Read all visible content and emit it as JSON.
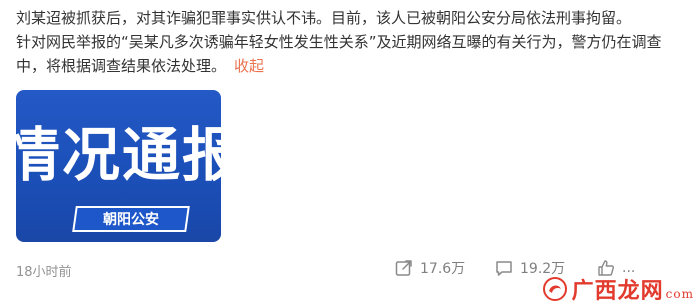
{
  "post": {
    "line1": "刘某迢被抓获后，对其诈骗犯罪事实供认不讳。目前，该人已被朝阳公安分局依法刑事拘留。",
    "line2": "针对网民举报的“吴某凡多次诱骗年轻女性发生性关系”及近期网络互曝的有关行为，警方仍在调查中，将根据调查结果依法处理。",
    "collapse_label": "收起"
  },
  "thumbnail": {
    "headline": "情况通报",
    "badge": "朝阳公安",
    "bg_color": "#1e57c9"
  },
  "footer": {
    "time": "18小时前",
    "repost_count": "17.6万",
    "comment_count": "19.2万",
    "like_count": "...",
    "repost_icon": "share-icon",
    "comment_icon": "comment-icon",
    "like_icon": "like-icon"
  },
  "watermark": {
    "brand": "广西龙网",
    "suffix": "com"
  }
}
